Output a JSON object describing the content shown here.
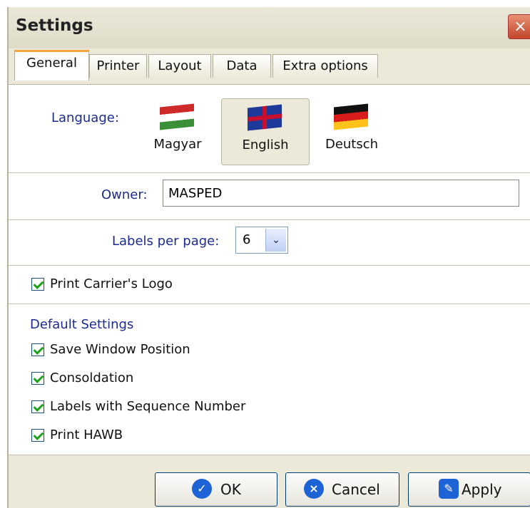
{
  "window": {
    "title": "Settings"
  },
  "tabs": [
    {
      "label": "General"
    },
    {
      "label": "Printer"
    },
    {
      "label": "Layout"
    },
    {
      "label": "Data"
    },
    {
      "label": "Extra options"
    }
  ],
  "language": {
    "label": "Language:",
    "options": [
      {
        "label": "Magyar",
        "icon": "hungary-flag-icon",
        "selected": false
      },
      {
        "label": "English",
        "icon": "uk-flag-icon",
        "selected": true
      },
      {
        "label": "Deutsch",
        "icon": "germany-flag-icon",
        "selected": false
      }
    ]
  },
  "owner": {
    "label": "Owner:",
    "value": "MASPED"
  },
  "labels_per_page": {
    "label": "Labels per page:",
    "value": "6"
  },
  "print_logo": {
    "label": "Print Carrier's Logo",
    "checked": true
  },
  "defaults": {
    "title": "Default Settings",
    "items": [
      {
        "label": "Save Window Position",
        "checked": true
      },
      {
        "label": "Consoldation",
        "checked": true
      },
      {
        "label": "Labels with Sequence Number",
        "checked": true
      },
      {
        "label": "Print HAWB",
        "checked": true
      }
    ]
  },
  "buttons": {
    "ok": "OK",
    "cancel": "Cancel",
    "apply": "Apply"
  }
}
